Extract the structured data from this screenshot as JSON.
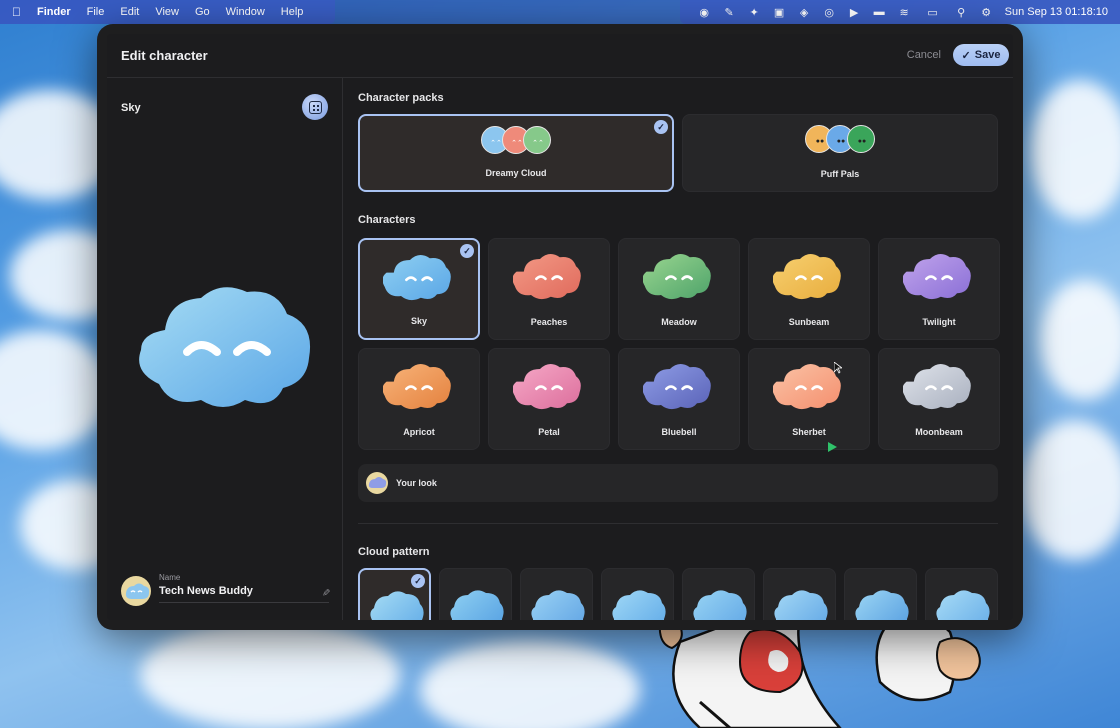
{
  "menubar": {
    "app": "Finder",
    "items": [
      "File",
      "Edit",
      "View",
      "Go",
      "Window",
      "Help"
    ],
    "clock": "Sun Sep 13  01:18:10"
  },
  "modal": {
    "title": "Edit character",
    "cancel_label": "Cancel",
    "save_label": "Save",
    "preview_name": "Sky",
    "name_field": {
      "label": "Name",
      "value": "Tech News Buddy"
    }
  },
  "sections": {
    "packs_title": "Character packs",
    "characters_title": "Characters",
    "pattern_title": "Cloud pattern",
    "your_look": "Your look"
  },
  "packs": [
    {
      "label": "Dreamy Cloud",
      "selected": true,
      "colors": [
        "#8cc6ef",
        "#ef8a7a",
        "#86c98a"
      ]
    },
    {
      "label": "Puff Pals",
      "selected": false,
      "colors": [
        "#f1b55a",
        "#6aa9e8",
        "#3aa55a"
      ]
    }
  ],
  "characters": [
    {
      "label": "Sky",
      "selected": true,
      "c1": "#8fd0f2",
      "c2": "#5aa6e6"
    },
    {
      "label": "Peaches",
      "selected": false,
      "c1": "#f39a86",
      "c2": "#e06a5c"
    },
    {
      "label": "Meadow",
      "selected": false,
      "c1": "#9ad690",
      "c2": "#4ea36a"
    },
    {
      "label": "Sunbeam",
      "selected": false,
      "c1": "#f7d070",
      "c2": "#e8ad3e"
    },
    {
      "label": "Twilight",
      "selected": false,
      "c1": "#c1a4ec",
      "c2": "#8a6fd6"
    },
    {
      "label": "Apricot",
      "selected": false,
      "c1": "#f8b47a",
      "c2": "#e4813e"
    },
    {
      "label": "Petal",
      "selected": false,
      "c1": "#f6a9c7",
      "c2": "#dc6e9c"
    },
    {
      "label": "Bluebell",
      "selected": false,
      "c1": "#8f9de6",
      "c2": "#5a63b8"
    },
    {
      "label": "Sherbet",
      "selected": false,
      "c1": "#fbc3a6",
      "c2": "#f48f6e"
    },
    {
      "label": "Moonbeam",
      "selected": false,
      "c1": "#dfe3ea",
      "c2": "#a9b0bf"
    }
  ],
  "colors": {
    "accent": "#a9c3f2",
    "panel": "#1c1c1e",
    "card": "#262628"
  }
}
